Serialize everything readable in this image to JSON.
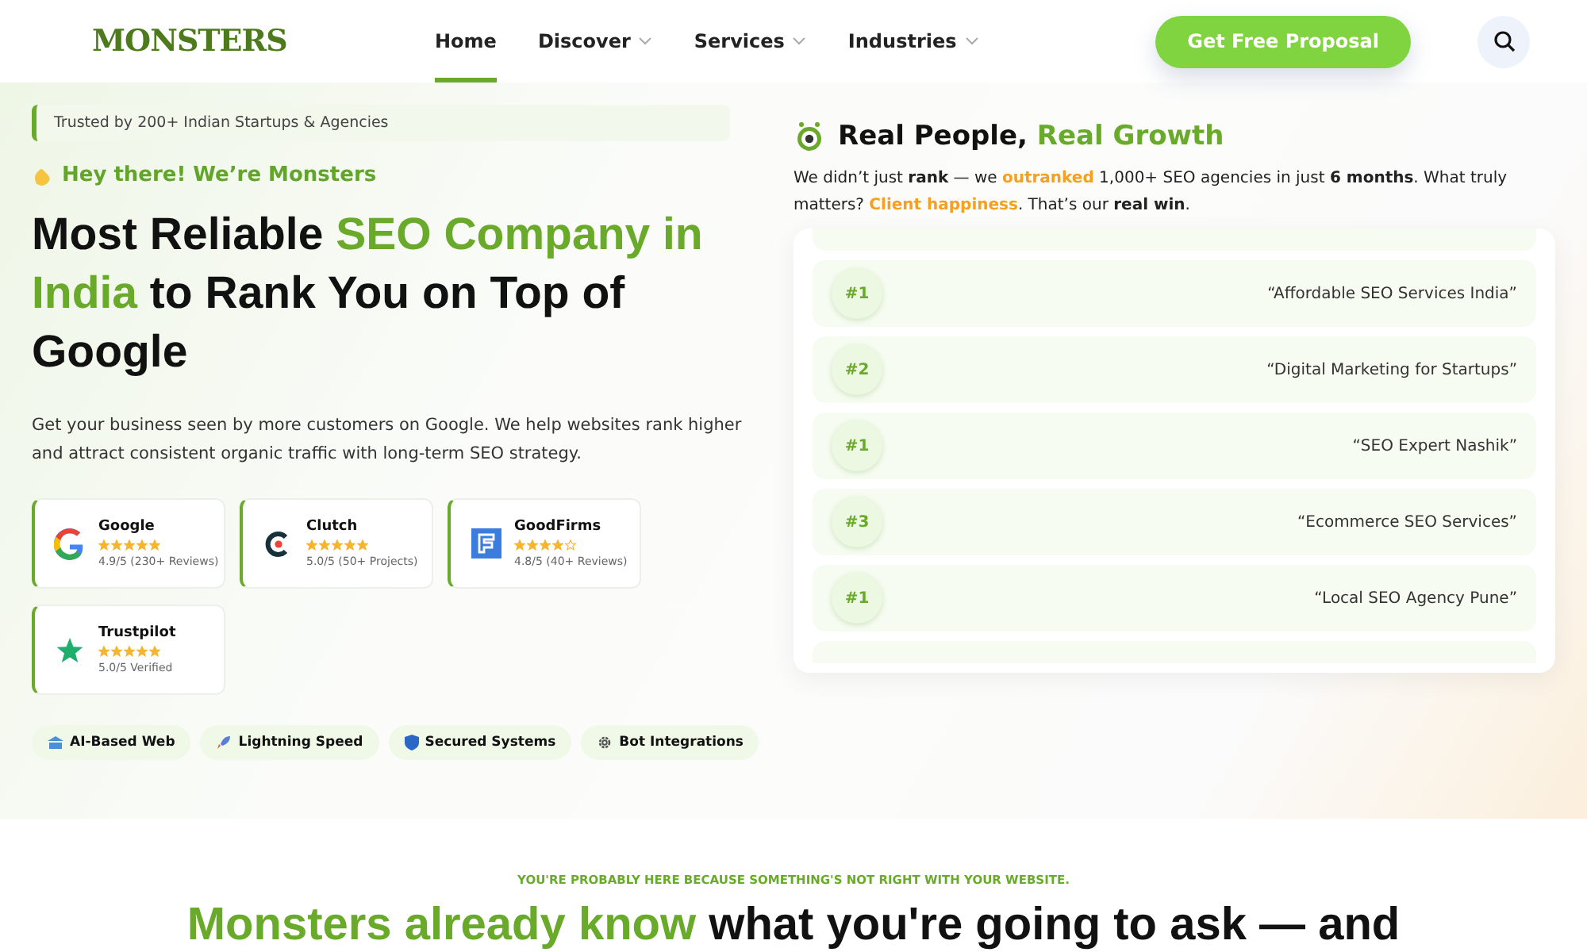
{
  "header": {
    "logo": "MONSTERS",
    "nav": [
      {
        "label": "Home",
        "selected": true,
        "has_menu": false
      },
      {
        "label": "Discover",
        "selected": false,
        "has_menu": true
      },
      {
        "label": "Services",
        "selected": false,
        "has_menu": true
      },
      {
        "label": "Industries",
        "selected": false,
        "has_menu": true
      }
    ],
    "cta": "Get Free Proposal"
  },
  "hero": {
    "trust_banner": "Trusted by 200+ Indian Startups & Agencies",
    "greeting": "Hey there! We’re Monsters",
    "headline": [
      {
        "text": "Most Reliable ",
        "kind": "plain"
      },
      {
        "text": "SEO Company in India",
        "kind": "accent"
      },
      {
        "text": " to Rank You on Top of Google",
        "kind": "plain"
      }
    ],
    "description": "Get your business seen by more customers on Google. We help websites rank higher and attract consistent organic traffic with long-term SEO strategy.",
    "reviews": [
      {
        "kind": "google",
        "name": "Google",
        "stars": 5,
        "detail": "4.9/5 (230+ Reviews)"
      },
      {
        "kind": "clutch",
        "name": "Clutch",
        "stars": 5,
        "detail": "5.0/5 (50+ Projects)"
      },
      {
        "kind": "goodfirms",
        "name": "GoodFirms",
        "stars": 4,
        "detail": "4.8/5 (40+ Reviews)"
      },
      {
        "kind": "trustpilot",
        "name": "Trustpilot",
        "stars": 5,
        "detail": "5.0/5 Verified"
      }
    ],
    "features": [
      {
        "kind": "ai",
        "label": "AI-Based Web"
      },
      {
        "kind": "speed",
        "label": "Lightning Speed"
      },
      {
        "kind": "security",
        "label": "Secured Systems"
      },
      {
        "kind": "bot",
        "label": "Bot Integrations"
      }
    ]
  },
  "growth": {
    "title": [
      {
        "text": "Real People,",
        "kind": "plain"
      },
      {
        "text": "Real Growth",
        "kind": "accent"
      }
    ],
    "text": [
      {
        "text": "We didn’t just ",
        "kind": "plain"
      },
      {
        "text": "rank",
        "kind": "bold"
      },
      {
        "text": " — we ",
        "kind": "plain"
      },
      {
        "text": "outranked",
        "kind": "orange"
      },
      {
        "text": " 1,000+ SEO agencies in just ",
        "kind": "plain"
      },
      {
        "text": "6 months",
        "kind": "bold"
      },
      {
        "text": ". What truly matters? ",
        "kind": "plain"
      },
      {
        "text": "Client happiness",
        "kind": "orange"
      },
      {
        "text": ". That’s our ",
        "kind": "plain"
      },
      {
        "text": "real win",
        "kind": "bold"
      },
      {
        "text": ".",
        "kind": "plain"
      }
    ],
    "rankings": [
      {
        "rank": "#1",
        "keyword": "“Affordable SEO Services India”"
      },
      {
        "rank": "#2",
        "keyword": "“Digital Marketing for Startups”"
      },
      {
        "rank": "#1",
        "keyword": "“SEO Expert Nashik”"
      },
      {
        "rank": "#3",
        "keyword": "“Ecommerce SEO Services”"
      },
      {
        "rank": "#1",
        "keyword": "“Local SEO Agency Pune”"
      }
    ]
  },
  "next_section": {
    "eyebrow": "YOU'RE PROBABLY HERE BECAUSE SOMETHING'S NOT RIGHT WITH YOUR WEBSITE.",
    "heading": [
      {
        "text": "Monsters already know",
        "kind": "accent"
      },
      {
        "text": " what you're going to ask — and",
        "kind": "plain"
      }
    ]
  }
}
